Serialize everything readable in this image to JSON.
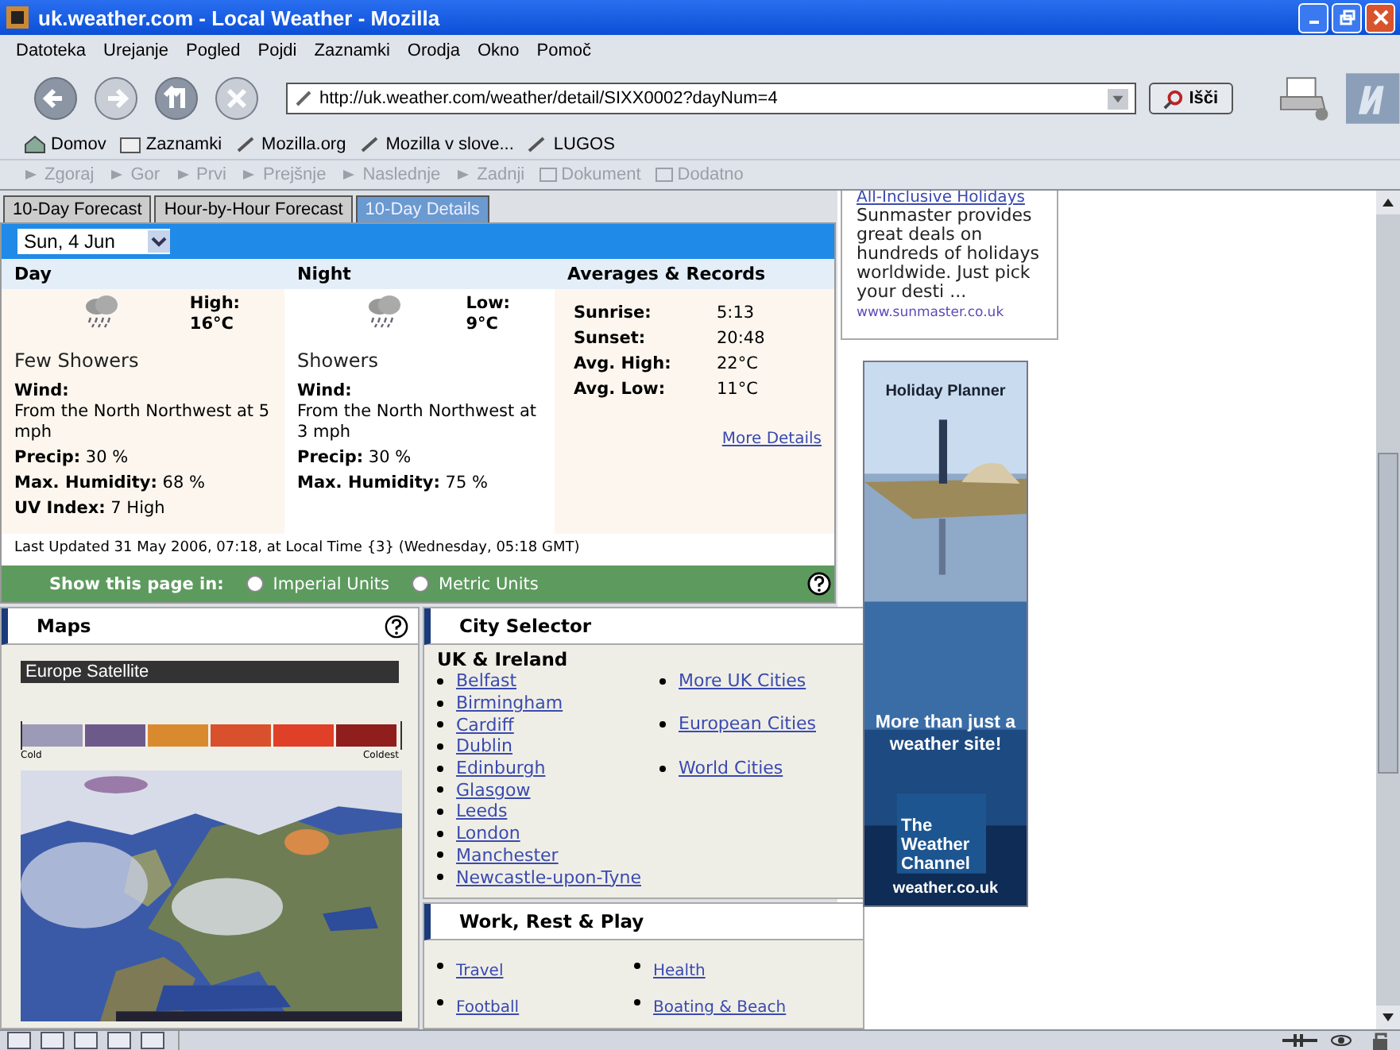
{
  "window": {
    "title": "uk.weather.com - Local Weather - Mozilla"
  },
  "menu": [
    "Datoteka",
    "Urejanje",
    "Pogled",
    "Pojdi",
    "Zaznamki",
    "Orodja",
    "Okno",
    "Pomoč"
  ],
  "nav_buttons": [
    {
      "kind": "back",
      "disabled": false
    },
    {
      "kind": "forward",
      "disabled": true
    },
    {
      "kind": "reload",
      "disabled": false
    },
    {
      "kind": "stop",
      "disabled": true
    }
  ],
  "address": {
    "value": "http://uk.weather.com/weather/detail/SIXX0002?dayNum=4"
  },
  "search_button": "Išči",
  "bookmarks": [
    {
      "kind": "home",
      "label": "Domov"
    },
    {
      "kind": "folder",
      "label": "Zaznamki"
    },
    {
      "kind": "link",
      "label": "Mozilla.org"
    },
    {
      "kind": "link",
      "label": "Mozilla v slove..."
    },
    {
      "kind": "link",
      "label": "LUGOS"
    }
  ],
  "site_nav": [
    {
      "kind": "arrow",
      "label": "Zgoraj",
      "disabled": true
    },
    {
      "kind": "arrow",
      "label": "Gor",
      "disabled": true
    },
    {
      "kind": "arrow",
      "label": "Prvi",
      "disabled": true
    },
    {
      "kind": "arrow",
      "label": "Prejšnje",
      "disabled": true
    },
    {
      "kind": "arrow",
      "label": "Naslednje",
      "disabled": true
    },
    {
      "kind": "arrow",
      "label": "Zadnji",
      "disabled": true
    },
    {
      "kind": "folder",
      "label": "Dokument",
      "disabled": true
    },
    {
      "kind": "folder",
      "label": "Dodatno",
      "disabled": true
    }
  ],
  "tabs": [
    {
      "label": "10-Day Forecast",
      "selected": false
    },
    {
      "label": "Hour-by-Hour Forecast",
      "selected": false
    },
    {
      "label": "10-Day Details",
      "selected": true
    }
  ],
  "date_select": {
    "value": "Sun, 4 Jun"
  },
  "periods": [
    {
      "heading": "Day",
      "temp_label": "High:",
      "temp": "16°C",
      "condition": "Few Showers",
      "details": [
        {
          "kind": "block",
          "label": "Wind:",
          "value": "From the North Northwest at 5 mph"
        },
        {
          "kind": "inline",
          "label": "Precip:",
          "value": "30 %"
        },
        {
          "kind": "inline",
          "label": "Max. Humidity:",
          "value": "68 %"
        },
        {
          "kind": "inline",
          "label": "UV Index:",
          "value": "7 High"
        }
      ]
    },
    {
      "heading": "Night",
      "temp_label": "Low:",
      "temp": "9°C",
      "condition": "Showers",
      "details": [
        {
          "kind": "block",
          "label": "Wind:",
          "value": "From the North Northwest at 3 mph"
        },
        {
          "kind": "inline",
          "label": "Precip:",
          "value": "30 %"
        },
        {
          "kind": "inline",
          "label": "Max. Humidity:",
          "value": "75 %"
        }
      ]
    }
  ],
  "averages": {
    "heading": "Averages & Records",
    "rows": [
      {
        "label": "Sunrise:",
        "value": "5:13"
      },
      {
        "label": "Sunset:",
        "value": "20:48"
      },
      {
        "label": "Avg. High:",
        "value": "22°C"
      },
      {
        "label": "Avg. Low:",
        "value": "11°C"
      }
    ],
    "link": "More Details"
  },
  "last_updated": "Last Updated 31 May 2006, 07:18, at Local Time {3} (Wednesday, 05:18 GMT)",
  "units": {
    "label": "Show this page in:",
    "options": [
      {
        "label": "Imperial Units",
        "selected": false
      },
      {
        "label": "Metric Units",
        "selected": false
      }
    ]
  },
  "maps": {
    "title": "Maps",
    "map_title": "Europe Satellite",
    "legend_low": "Cold",
    "legend_high": "Coldest"
  },
  "city_selector": {
    "title": "City Selector",
    "region": "UK & Ireland",
    "cities": [
      "Belfast",
      "Birmingham",
      "Cardiff",
      "Dublin",
      "Edinburgh",
      "Glasgow",
      "Leeds",
      "London",
      "Manchester",
      "Newcastle-upon-Tyne"
    ],
    "more": [
      "More UK Cities",
      "European Cities",
      "World Cities"
    ]
  },
  "work_rest_play": {
    "title": "Work, Rest & Play",
    "links": [
      "Travel",
      "Health",
      "Football",
      "Boating & Beach"
    ]
  },
  "text_ad": {
    "link": "All-Inclusive Holidays",
    "body": "Sunmaster provides great deals on hundreds of holidays worldwide. Just pick your desti ...",
    "url": "www.sunmaster.co.uk"
  },
  "banner": {
    "title": "Holiday Planner",
    "slogan": "More than just a weather site!",
    "brand": "The Weather Channel",
    "site": "weather.co.uk"
  }
}
